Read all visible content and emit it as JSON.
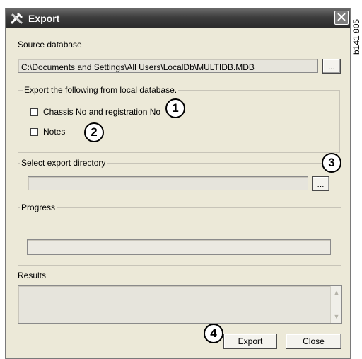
{
  "window": {
    "title": "Export",
    "title_icon": "export-tools-icon"
  },
  "side_label": "b141 805",
  "source": {
    "label": "Source database",
    "path": "C:\\Documents and Settings\\All Users\\LocalDb\\MULTIDB.MDB",
    "browse_label": "..."
  },
  "export_group": {
    "title": "Export the following from local database.",
    "options": [
      {
        "label": "Chassis No and registration No",
        "checked": false
      },
      {
        "label": "Notes",
        "checked": false
      }
    ]
  },
  "directory_group": {
    "title": "Select export directory",
    "value": "",
    "browse_label": "..."
  },
  "progress_group": {
    "title": "Progress"
  },
  "results": {
    "label": "Results"
  },
  "buttons": {
    "export": "Export",
    "close": "Close"
  },
  "callouts": [
    "1",
    "2",
    "3",
    "4"
  ]
}
